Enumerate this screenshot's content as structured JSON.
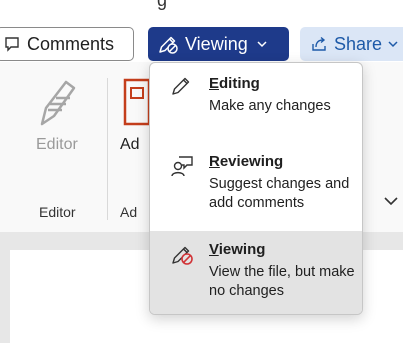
{
  "toolbar": {
    "top_partial_text": "g",
    "comments_label": "Comments",
    "viewing_label": "Viewing",
    "share_label": "Share"
  },
  "ribbon": {
    "editor_label": "Editor",
    "editor_group_label": "Editor",
    "addins_label": "Ad",
    "addins_group_label": "Ad"
  },
  "menu": {
    "items": [
      {
        "title_underlined": "E",
        "title_rest": "diting",
        "description": "Make any changes",
        "icon": "pencil-icon"
      },
      {
        "title_underlined": "R",
        "title_rest": "eviewing",
        "description": "Suggest changes and add comments",
        "icon": "person-comment-icon"
      },
      {
        "title_underlined": "V",
        "title_rest": "iewing",
        "description": "View the file, but make no changes",
        "icon": "pencil-prohibited-icon",
        "selected": true
      }
    ]
  },
  "colors": {
    "viewing_button_bg": "#1e3a8a",
    "share_button_bg": "#dbe6f6",
    "prohibited_red": "#d13438",
    "addin_icon_red": "#c43e1c"
  }
}
